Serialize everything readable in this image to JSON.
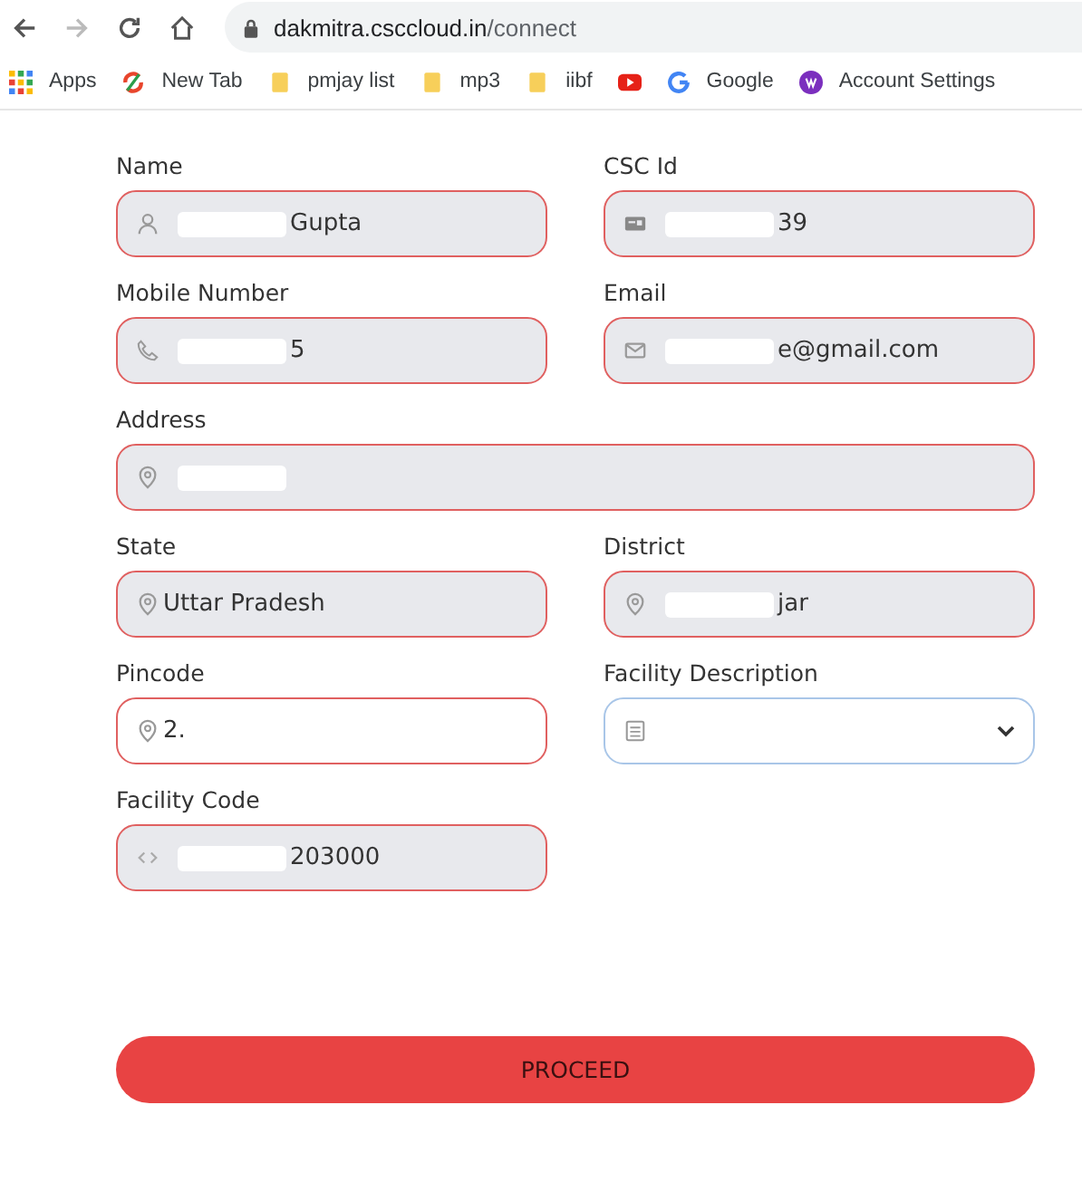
{
  "browser": {
    "url_host": "dakmitra.csccloud.in",
    "url_path": "/connect"
  },
  "bookmarks": [
    {
      "label": "Apps"
    },
    {
      "label": "New Tab"
    },
    {
      "label": "pmjay list"
    },
    {
      "label": "mp3"
    },
    {
      "label": "iibf"
    },
    {
      "kind": "icon"
    },
    {
      "label": "Google"
    },
    {
      "label": "Account Settings"
    }
  ],
  "fields": [
    {
      "label": "Name",
      "value": "Gupta",
      "redacted": true,
      "readonly": true,
      "focused": false,
      "kind": "input"
    },
    {
      "label": "CSC Id",
      "value": "39",
      "redacted": true,
      "readonly": true,
      "focused": false,
      "kind": "input"
    },
    {
      "label": "Mobile Number",
      "value": "5",
      "redacted": true,
      "readonly": true,
      "focused": false,
      "kind": "input"
    },
    {
      "label": "Email",
      "value": "e@gmail.com",
      "redacted": true,
      "readonly": true,
      "focused": false,
      "kind": "input"
    },
    {
      "label": "Address",
      "redacted": true,
      "readonly": true,
      "focused": false,
      "kind": "wide"
    },
    {
      "label": "State",
      "value": "Uttar Pradesh",
      "redacted": false,
      "readonly": true,
      "focused": false,
      "kind": "input"
    },
    {
      "label": "District",
      "value": "jar",
      "redacted": true,
      "readonly": true,
      "focused": false,
      "kind": "input"
    },
    {
      "label": "Pincode",
      "value": "2.",
      "redacted": false,
      "readonly": false,
      "focused": false,
      "kind": "input"
    },
    {
      "label": "Facility Description",
      "redacted": false,
      "readonly": false,
      "focused": true,
      "kind": "select"
    },
    {
      "label": "Facility Code",
      "value": "203000",
      "redacted": true,
      "readonly": true,
      "focused": false,
      "kind": "input"
    }
  ],
  "submit": {
    "label": "PROCEED"
  }
}
